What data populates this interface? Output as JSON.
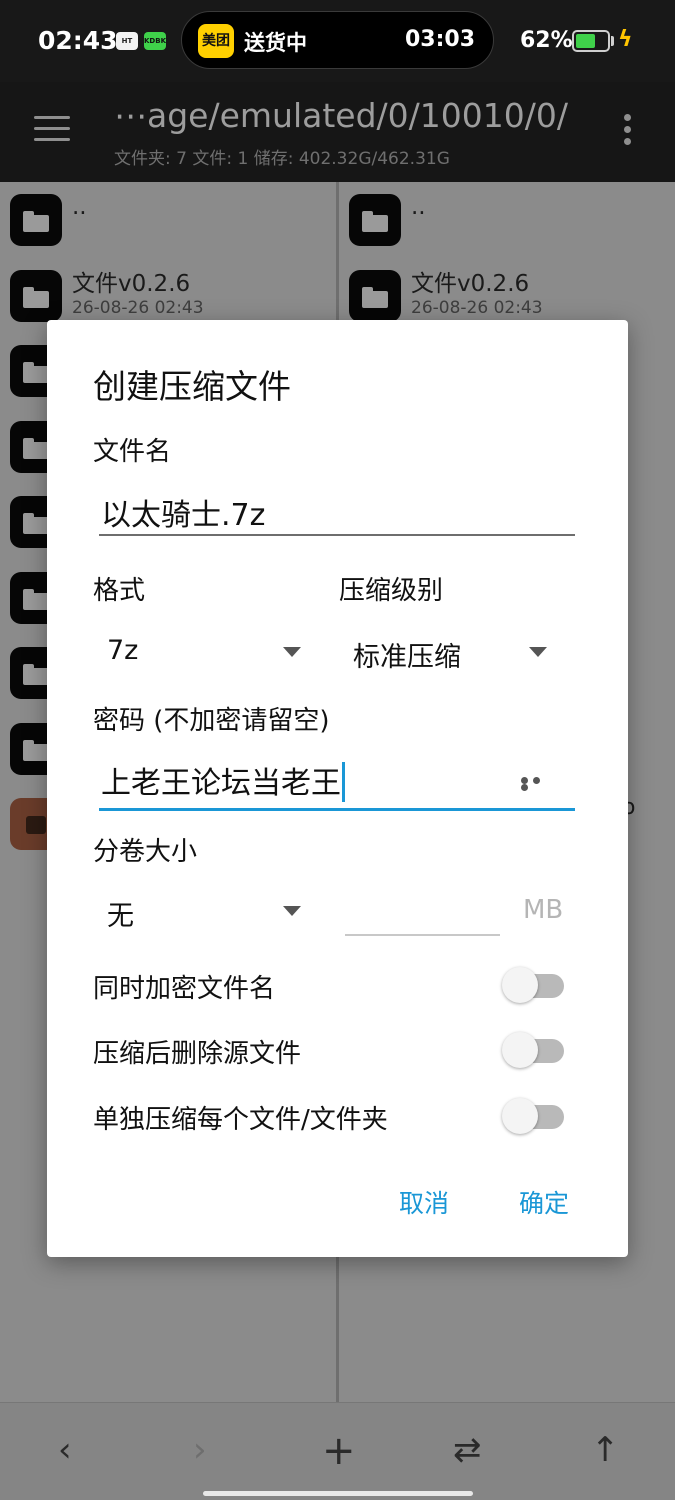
{
  "status_bar": {
    "time": "02:43",
    "mini_icon_1": "HT",
    "mini_icon_2": "KDBK",
    "live_app": "美团",
    "live_text": "送货中",
    "live_time": "03:03",
    "battery_pct": "62%",
    "battery_level": 0.62,
    "battery_color": "#3fd14a"
  },
  "toolbar": {
    "path": "⋯age/emulated/0/10010/0/",
    "info": "文件夹: 7  文件: 1  储存: 402.32G/462.31G"
  },
  "left_pane": [
    {
      "name": "..",
      "date": "",
      "type": "folder"
    },
    {
      "name": "文件v0.2.6",
      "date": "26-08-26 02:43",
      "type": "folder"
    },
    {
      "name": "",
      "date": "",
      "type": "folder"
    },
    {
      "name": "",
      "date": "",
      "type": "folder"
    },
    {
      "name": "",
      "date": "",
      "type": "folder"
    },
    {
      "name": "",
      "date": "",
      "type": "folder"
    },
    {
      "name": "",
      "date": "",
      "type": "folder"
    },
    {
      "name": "",
      "date": "",
      "type": "folder"
    },
    {
      "name": "",
      "date": "",
      "type": "archive"
    }
  ],
  "right_pane": [
    {
      "name": "..",
      "date": "",
      "type": "folder"
    },
    {
      "name": "文件v0.2.6",
      "date": "26-08-26 02:43",
      "type": "folder"
    }
  ],
  "right_pane_partial_text": "o",
  "dialog": {
    "title": "创建压缩文件",
    "filename_label": "文件名",
    "filename_value": "以太骑士.7z",
    "format_label": "格式",
    "format_value": "7z",
    "level_label": "压缩级别",
    "level_value": "标准压缩",
    "password_label": "密码 (不加密请留空)",
    "password_value": "上老王论坛当老王",
    "volume_label": "分卷大小",
    "volume_value": "无",
    "volume_size_value": "",
    "volume_unit": "MB",
    "toggles": [
      {
        "label": "同时加密文件名",
        "on": false
      },
      {
        "label": "压缩后删除源文件",
        "on": false
      },
      {
        "label": "单独压缩每个文件/文件夹",
        "on": false
      }
    ],
    "cancel_label": "取消",
    "ok_label": "确定",
    "accent_color": "#1a97d6"
  },
  "bottom_nav": {
    "back_icon": "‹",
    "forward_icon": "›",
    "add_icon": "+",
    "swap_icon": "⇄",
    "up_icon": "↑"
  }
}
